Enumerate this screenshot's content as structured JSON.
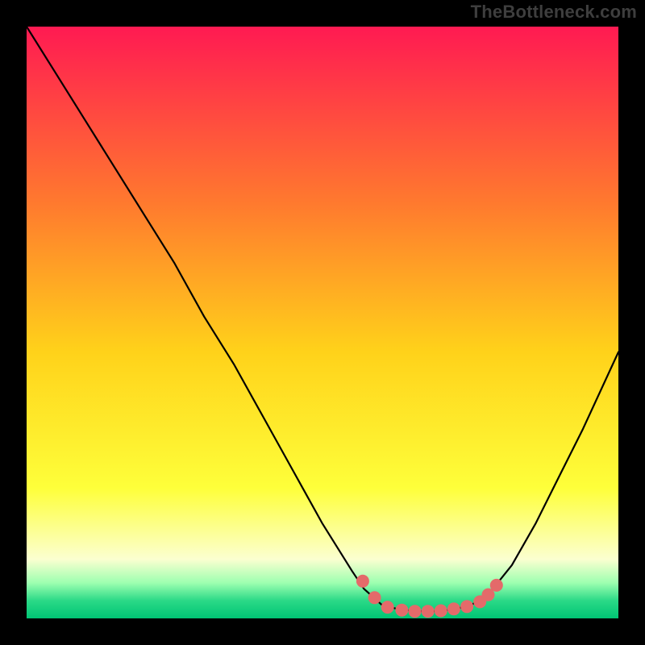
{
  "watermark": "TheBottleneck.com",
  "colors": {
    "bg_black": "#000000",
    "grad_top": "#ff1a52",
    "grad_upper_mid": "#ff7a2e",
    "grad_mid": "#ffd21a",
    "grad_lower_mid": "#feff3a",
    "grad_pale": "#fbffd0",
    "grad_green1": "#9dffb0",
    "grad_green2": "#2bd987",
    "grad_green3": "#00c574",
    "curve": "#000000",
    "dots": "#e46a6a"
  },
  "chart_data": {
    "type": "line",
    "title": "",
    "xlabel": "",
    "ylabel": "",
    "xlim": [
      0,
      100
    ],
    "ylim": [
      0,
      100
    ],
    "series": [
      {
        "name": "bottleneck-curve",
        "x": [
          0,
          5,
          10,
          15,
          20,
          25,
          30,
          35,
          40,
          45,
          50,
          55,
          57,
          60,
          63,
          66,
          69,
          72,
          75,
          78,
          82,
          86,
          90,
          94,
          100
        ],
        "y": [
          100,
          92,
          84,
          76,
          68,
          60,
          51,
          43,
          34,
          25,
          16,
          8,
          5,
          2.3,
          1.5,
          1.2,
          1.2,
          1.5,
          2.2,
          4,
          9,
          16,
          24,
          32,
          45
        ]
      }
    ],
    "dots": [
      {
        "x": 56.8,
        "y": 6.3
      },
      {
        "x": 58.8,
        "y": 3.5
      },
      {
        "x": 61.0,
        "y": 1.9
      },
      {
        "x": 63.4,
        "y": 1.4
      },
      {
        "x": 65.6,
        "y": 1.2
      },
      {
        "x": 67.8,
        "y": 1.2
      },
      {
        "x": 70.0,
        "y": 1.3
      },
      {
        "x": 72.2,
        "y": 1.6
      },
      {
        "x": 74.4,
        "y": 2.0
      },
      {
        "x": 76.6,
        "y": 2.8
      },
      {
        "x": 78.0,
        "y": 4.0
      },
      {
        "x": 79.4,
        "y": 5.6
      }
    ]
  }
}
